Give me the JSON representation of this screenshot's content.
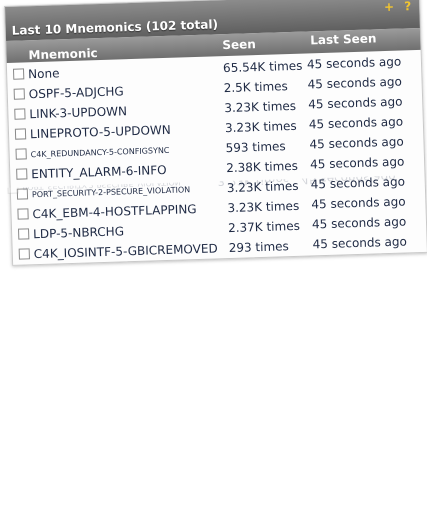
{
  "widget": {
    "title": "Last 10 Mnemonics (102 total)",
    "icons": [
      "+",
      "?"
    ],
    "columns": {
      "mnemonic": "Mnemonic",
      "seen": "Seen",
      "last_seen": "Last Seen"
    },
    "rows": [
      {
        "mnemonic": "None",
        "seen": "65.54K times",
        "last": "45 seconds ago",
        "small": false
      },
      {
        "mnemonic": "OSPF-5-ADJCHG",
        "seen": "2.5K times",
        "last": "45 seconds ago",
        "small": false
      },
      {
        "mnemonic": "LINK-3-UPDOWN",
        "seen": "3.23K times",
        "last": "45 seconds ago",
        "small": false
      },
      {
        "mnemonic": "LINEPROTO-5-UPDOWN",
        "seen": "3.23K times",
        "last": "45 seconds ago",
        "small": false
      },
      {
        "mnemonic": "C4K_REDUNDANCY-5-CONFIGSYNC",
        "seen": "593 times",
        "last": "45 seconds ago",
        "small": true
      },
      {
        "mnemonic": "ENTITY_ALARM-6-INFO",
        "seen": "2.38K times",
        "last": "45 seconds ago",
        "small": false
      },
      {
        "mnemonic": "PORT_SECURITY-2-PSECURE_VIOLATION",
        "seen": "3.23K times",
        "last": "45 seconds ago",
        "small": true
      },
      {
        "mnemonic": "C4K_EBM-4-HOSTFLAPPING",
        "seen": "3.23K times",
        "last": "45 seconds ago",
        "small": false
      },
      {
        "mnemonic": "LDP-5-NBRCHG",
        "seen": "2.37K times",
        "last": "45 seconds ago",
        "small": false
      },
      {
        "mnemonic": "C4K_IOSINTF-5-GBICREMOVED",
        "seen": "293 times",
        "last": "45 seconds ago",
        "small": false
      }
    ]
  }
}
